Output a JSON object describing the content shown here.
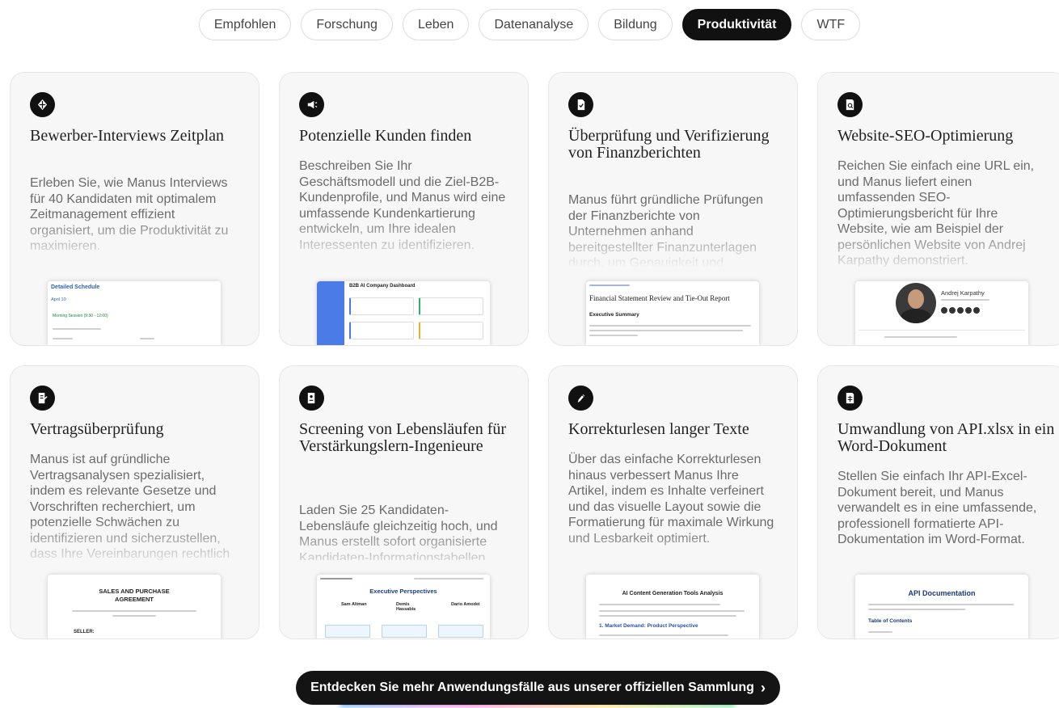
{
  "tabs": [
    {
      "label": "Empfohlen"
    },
    {
      "label": "Forschung"
    },
    {
      "label": "Leben"
    },
    {
      "label": "Datenanalyse"
    },
    {
      "label": "Bildung"
    },
    {
      "label": "Produktivität",
      "active": true
    },
    {
      "label": "WTF"
    }
  ],
  "cards": [
    {
      "title": "Bewerber-Interviews Zeitplan",
      "description": "Erleben Sie, wie Manus Interviews für 40 Kandidaten mit optimalem Zeitmanagement effizient organisiert, um die Produktivität zu maximieren.",
      "icon": "calendar-icon",
      "preview": {
        "heading": "Detailed Schedule",
        "sub": "April 10",
        "note": "Morning Session (9:30 - 12:00)"
      }
    },
    {
      "title": "Potenzielle Kunden finden",
      "description": "Beschreiben Sie Ihr Geschäftsmodell und die Ziel-B2B-Kundenprofile, und Manus wird eine umfassende Kundenkartierung entwickeln, um Ihre idealen Interessenten zu identifizieren.",
      "icon": "megaphone-icon",
      "preview": {
        "heading": "B2B AI Company Dashboard"
      }
    },
    {
      "title": "Überprüfung und Verifizierung von Finanzberichten",
      "description": "Manus führt gründliche Prüfungen der Finanzberichte von Unternehmen anhand bereitgestellter Finanzunterlagen durch, um Genauigkeit und",
      "icon": "document-check-icon",
      "preview": {
        "heading": "Financial Statement Review and Tie-Out Report",
        "sub": "Executive Summary"
      }
    },
    {
      "title": "Website-SEO-Optimierung",
      "description": "Reichen Sie einfach eine URL ein, und Manus liefert einen umfassenden SEO-Optimierungsbericht für Ihre Website, wie am Beispiel der persönlichen Website von Andrej Karpathy demonstriert.",
      "icon": "search-document-icon",
      "preview": {
        "heading": "Andrej Karpathy"
      }
    },
    {
      "title": "Vertragsüberprüfung",
      "description": "Manus ist auf gründliche Vertragsanalysen spezialisiert, indem es relevante Gesetze und Vorschriften recherchiert, um potenzielle Schwächen zu identifizieren und sicherzustellen, dass Ihre Vereinbarungen rechtlich",
      "icon": "contract-icon",
      "preview": {
        "heading": "SALES AND PURCHASE AGREEMENT",
        "sub": "SELLER:"
      }
    },
    {
      "title": "Screening von Lebensläufen für Verstärkungslern-Ingenieure",
      "description": "Laden Sie 25 Kandidaten-Lebensläufe gleichzeitig hoch, und Manus erstellt sofort organisierte Kandidaten-Informationstabellen",
      "icon": "resume-icon",
      "preview": {
        "heading": "Executive Perspectives",
        "names": [
          "Sam Altman",
          "Demis Hassabis",
          "Dario Amodei"
        ]
      }
    },
    {
      "title": "Korrekturlesen langer Texte",
      "description": "Über das einfache Korrekturlesen hinaus verbessert Manus Ihre Artikel, indem es Inhalte verfeinert und das visuelle Layout sowie die Formatierung für maximale Wirkung und Lesbarkeit optimiert.",
      "icon": "pen-icon",
      "preview": {
        "heading": "AI Content Generation Tools Analysis",
        "sub": "1. Market Demand: Product Perspective"
      }
    },
    {
      "title": "Umwandlung von API.xlsx in ein Word-Dokument",
      "description": "Stellen Sie einfach Ihr API-Excel-Dokument bereit, und Manus verwandelt es in eine umfassende, professionell formatierte API-Dokumentation im Word-Format.",
      "icon": "spreadsheet-icon",
      "preview": {
        "heading": "API Documentation",
        "sub": "Table of Contents"
      }
    }
  ],
  "cta": {
    "label": "Entdecken Sie mehr Anwendungsfälle aus unserer offiziellen Sammlung",
    "arrow": "›"
  }
}
